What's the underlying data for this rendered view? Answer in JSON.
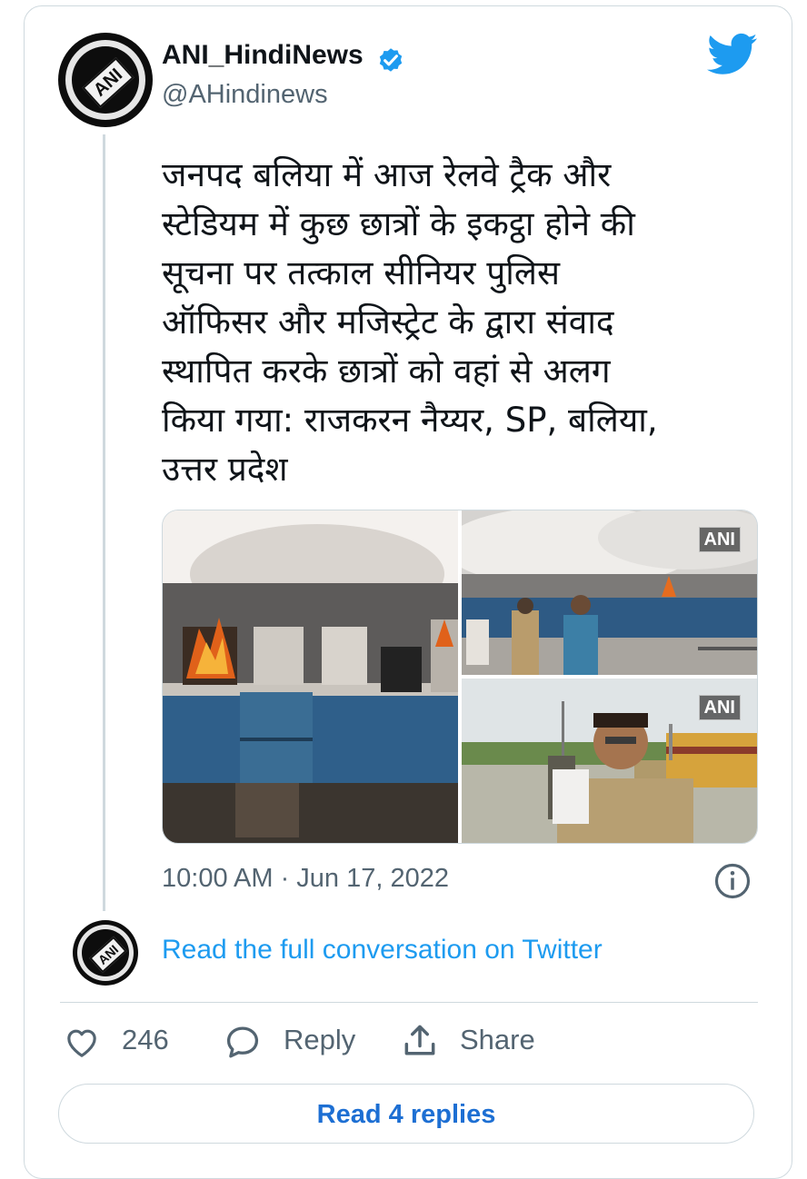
{
  "header": {
    "display_name": "ANI_HindiNews",
    "handle": "@AHindinews",
    "verified": true,
    "avatar_text": "ANI",
    "platform_icon": "twitter-bird-icon"
  },
  "tweet": {
    "text": "जनपद बलिया में आज रेलवे ट्रैक और\nस्टेडियम में कुछ छात्रों के इकट्ठा होने की\nसूचना पर तत्काल सीनियर पुलिस\nऑफिसर और मजिस्ट्रेट के द्वारा संवाद\nस्थापित करके छात्रों को वहां से अलग\nकिया गया: राजकरन नैय्यर, SP, बलिया,\nउत्तर प्रदेश",
    "media": [
      {
        "description": "burning train coach"
      },
      {
        "description": "train on fire with police",
        "watermark": "ANI"
      },
      {
        "description": "police officer speaking at station",
        "watermark": "ANI"
      }
    ],
    "timestamp": "10:00 AM · Jun 17, 2022"
  },
  "conversation": {
    "link_text": "Read the full conversation on Twitter"
  },
  "actions": {
    "like_count": "246",
    "reply_label": "Reply",
    "share_label": "Share"
  },
  "replies_button": "Read 4 replies",
  "colors": {
    "accent": "#1d9bf0",
    "text": "#0f1419",
    "secondary": "#536471",
    "border": "#cfd9de"
  }
}
